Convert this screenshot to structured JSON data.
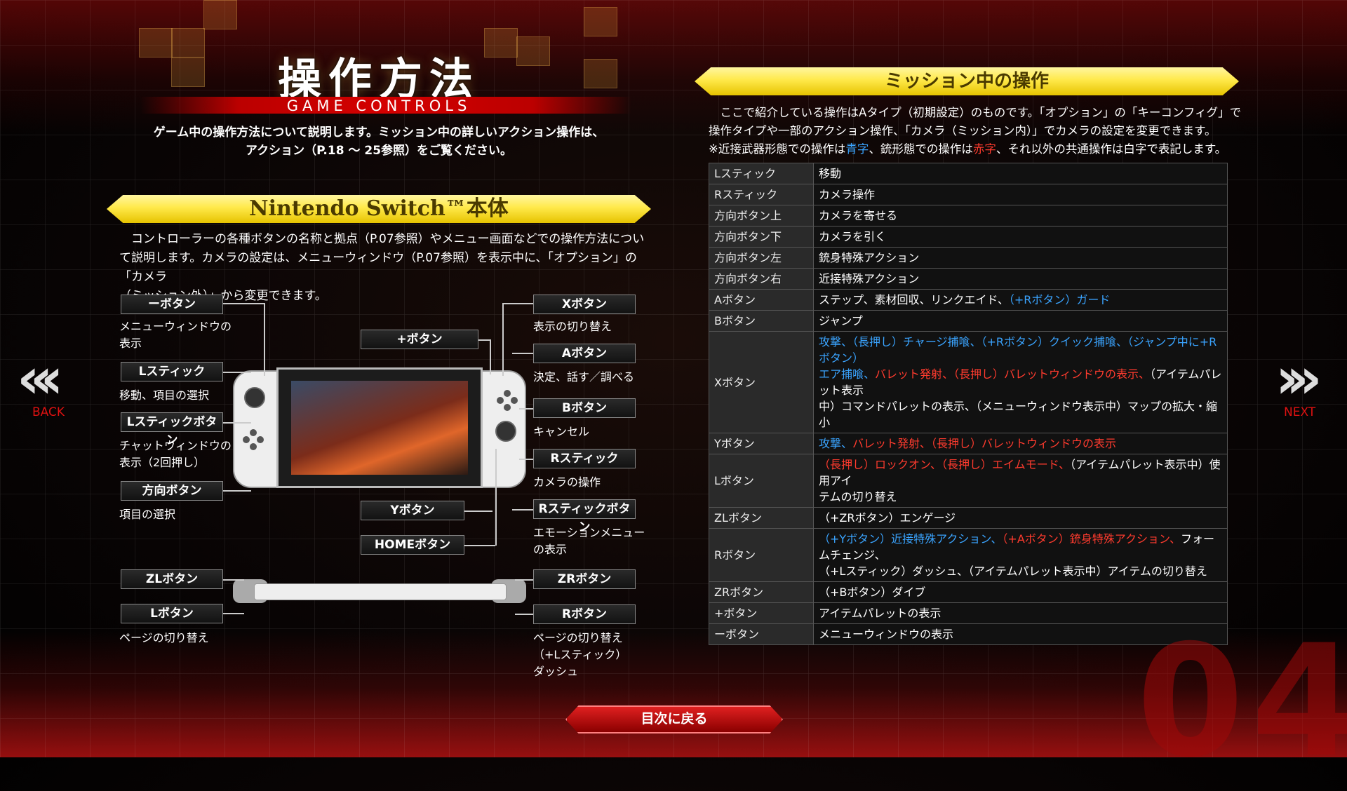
{
  "header": {
    "title_jp": "操作方法",
    "title_en": "GAME CONTROLS",
    "intro_line1": "ゲーム中の操作方法について説明します。ミッション中の詳しいアクション操作は、",
    "intro_line2": "アクション（P.18 〜 25参照）をご覧ください。"
  },
  "left": {
    "banner": "Nintendo Switch™本体",
    "para_line1": "　コントローラーの各種ボタンの名称と拠点（P.07参照）やメニュー画面などでの操作方法につい",
    "para_line2": "て説明します。カメラの設定は、メニューウィンドウ（P.07参照）を表示中に、「オプション」の「カメラ",
    "para_line3": "（ミッション外）」から変更できます。",
    "buttons": {
      "minus": {
        "label": "ーボタン",
        "desc1": "メニューウィンドウの",
        "desc2": "表示"
      },
      "lstick": {
        "label": "Lスティック",
        "desc1": "移動、項目の選択"
      },
      "lstickbtn": {
        "label": "Lスティックボタン",
        "desc1": "チャットウィンドウの",
        "desc2": "表示（2回押し）"
      },
      "dpad": {
        "label": "方向ボタン",
        "desc1": "項目の選択"
      },
      "plus": {
        "label": "+ボタン"
      },
      "y": {
        "label": "Yボタン"
      },
      "home": {
        "label": "HOMEボタン"
      },
      "x": {
        "label": "Xボタン",
        "desc1": "表示の切り替え"
      },
      "a": {
        "label": "Aボタン",
        "desc1": "決定、話す／調べる"
      },
      "b": {
        "label": "Bボタン",
        "desc1": "キャンセル"
      },
      "rstick": {
        "label": "Rスティック",
        "desc1": "カメラの操作"
      },
      "rstickbtn": {
        "label": "Rスティックボタン",
        "desc1": "エモーションメニュー",
        "desc2": "の表示"
      },
      "zl": {
        "label": "ZLボタン"
      },
      "l": {
        "label": "Lボタン",
        "desc1": "ページの切り替え"
      },
      "zr": {
        "label": "ZRボタン"
      },
      "r": {
        "label": "Rボタン",
        "desc1": "ページの切り替え",
        "desc2": "（+Lスティック）",
        "desc3": "ダッシュ"
      }
    }
  },
  "right": {
    "banner": "ミッション中の操作",
    "note_line1": "　ここで紹介している操作はAタイプ（初期設定）のものです。「オプション」の「キーコンフィグ」で",
    "note_line2": "操作タイプや一部のアクション操作、「カメラ（ミッション内）」でカメラの設定を変更できます。",
    "note_line3a": "※近接武器形態での操作は",
    "note_blue": "青字",
    "note_line3b": "、銃形態での操作は",
    "note_red": "赤字",
    "note_line3c": "、それ以外の共通操作は白字で表記します。",
    "rows": [
      {
        "key": "Lスティック",
        "val": "移動"
      },
      {
        "key": "Rスティック",
        "val": "カメラ操作"
      },
      {
        "key": "方向ボタン上",
        "val": "カメラを寄せる"
      },
      {
        "key": "方向ボタン下",
        "val": "カメラを引く"
      },
      {
        "key": "方向ボタン左",
        "val": "銃身特殊アクション"
      },
      {
        "key": "方向ボタン右",
        "val": "近接特殊アクション"
      },
      {
        "key": "Aボタン",
        "val_a": "ステップ、素材回収、リンクエイド、",
        "val_b": "（+Rボタン）ガード"
      },
      {
        "key": "Bボタン",
        "val": "ジャンプ"
      },
      {
        "key": "Xボタン",
        "val_a": "攻撃、（長押し）チャージ捕喰、（+Rボタン）クイック捕喰、（ジャンプ中に+Rボタン）",
        "val_b": "エア捕喰、",
        "val_c": "バレット発射、（長押し）バレットウィンドウの表示、",
        "val_d": "（アイテムパレット表示",
        "val_e": "中）コマンドパレットの表示、（メニューウィンドウ表示中）マップの拡大・縮小"
      },
      {
        "key": "Yボタン",
        "val_a": "攻撃、",
        "val_b": "バレット発射、（長押し）バレットウィンドウの表示"
      },
      {
        "key": "Lボタン",
        "val_a": "（長押し）ロックオン、（長押し）エイムモード、",
        "val_b": "（アイテムパレット表示中）使用アイ",
        "val_c": "テムの切り替え"
      },
      {
        "key": "ZLボタン",
        "val": "（+ZRボタン）エンゲージ"
      },
      {
        "key": "Rボタン",
        "val_a": "（+Yボタン）近接特殊アクション、",
        "val_b": "（+Aボタン）銃身特殊アクション、",
        "val_c": "フォームチェンジ、",
        "val_d": "（+Lスティック）ダッシュ、（アイテムパレット表示中）アイテムの切り替え"
      },
      {
        "key": "ZRボタン",
        "val": "（+Bボタン）ダイブ"
      },
      {
        "key": "+ボタン",
        "val": "アイテムパレットの表示"
      },
      {
        "key": "ーボタン",
        "val": "メニューウィンドウの表示"
      }
    ]
  },
  "nav": {
    "back": "BACK",
    "next": "NEXT",
    "toc": "目次に戻る",
    "page": "04"
  }
}
